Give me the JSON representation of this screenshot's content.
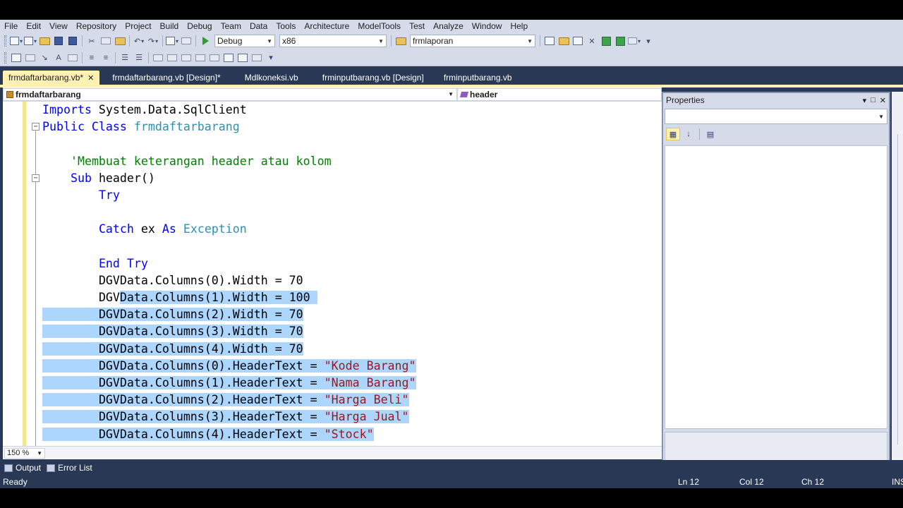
{
  "menu": [
    "File",
    "Edit",
    "View",
    "Repository",
    "Project",
    "Build",
    "Debug",
    "Team",
    "Data",
    "Tools",
    "Architecture",
    "ModelTools",
    "Test",
    "Analyze",
    "Window",
    "Help"
  ],
  "toolbar": {
    "config": "Debug",
    "platform": "x86",
    "find": "frmlaporan"
  },
  "tabs": [
    {
      "label": "frmdaftarbarang.vb*",
      "active": true,
      "close": "✕"
    },
    {
      "label": "frmdaftarbarang.vb [Design]*"
    },
    {
      "label": "Mdlkoneksi.vb"
    },
    {
      "label": "frminputbarang.vb [Design]"
    },
    {
      "label": "frminputbarang.vb"
    }
  ],
  "editor": {
    "class_combo": "frmdaftarbarang",
    "member_combo": "header",
    "zoom": "150 %"
  },
  "code": {
    "l1_kw": "Imports",
    "l1_rest": " System.Data.SqlClient",
    "l2_kw": "Public Class",
    "l2_name": "frmdaftarbarang",
    "l4_comment": "'Membuat keterangan header atau kolom",
    "l5_kw": "Sub",
    "l5_rest": " header()",
    "l6_kw": "Try",
    "l8_kw1": "Catch",
    "l8_mid": " ex ",
    "l8_kw2": "As",
    "l8_ty": "Exception",
    "l10_kw": "End Try",
    "l11": "DGVData.Columns(0).Width = 70",
    "l12_a": "DGV",
    "l12_b": "Data.Columns(1).Width = 100",
    "l13": "DGVData.Columns(2).Width = 70",
    "l14": "DGVData.Columns(3).Width = 70",
    "l15": "DGVData.Columns(4).Width = 70",
    "l16_a": "DGVData.Columns(0).HeaderText = ",
    "l16_s": "\"Kode Barang\"",
    "l17_a": "DGVData.Columns(1).HeaderText = ",
    "l17_s": "\"Nama Barang\"",
    "l18_a": "DGVData.Columns(2).HeaderText = ",
    "l18_s": "\"Harga Beli\"",
    "l19_a": "DGVData.Columns(3).HeaderText = ",
    "l19_s": "\"Harga Jual\"",
    "l20_a": "DGVData.Columns(4).HeaderText = ",
    "l20_s": "\"Stock\""
  },
  "properties": {
    "title": "Properties"
  },
  "bottom_tabs": [
    "Output",
    "Error List"
  ],
  "status": {
    "state": "Ready",
    "ln": "Ln 12",
    "col": "Col 12",
    "ch": "Ch 12",
    "mode": "INS"
  },
  "colors": {
    "chrome": "#293955",
    "keyword": "#0000ff",
    "type": "#2b91af",
    "comment": "#008000",
    "string": "#a31515",
    "selection": "#add6ff",
    "active_tab": "#fff1b4"
  }
}
